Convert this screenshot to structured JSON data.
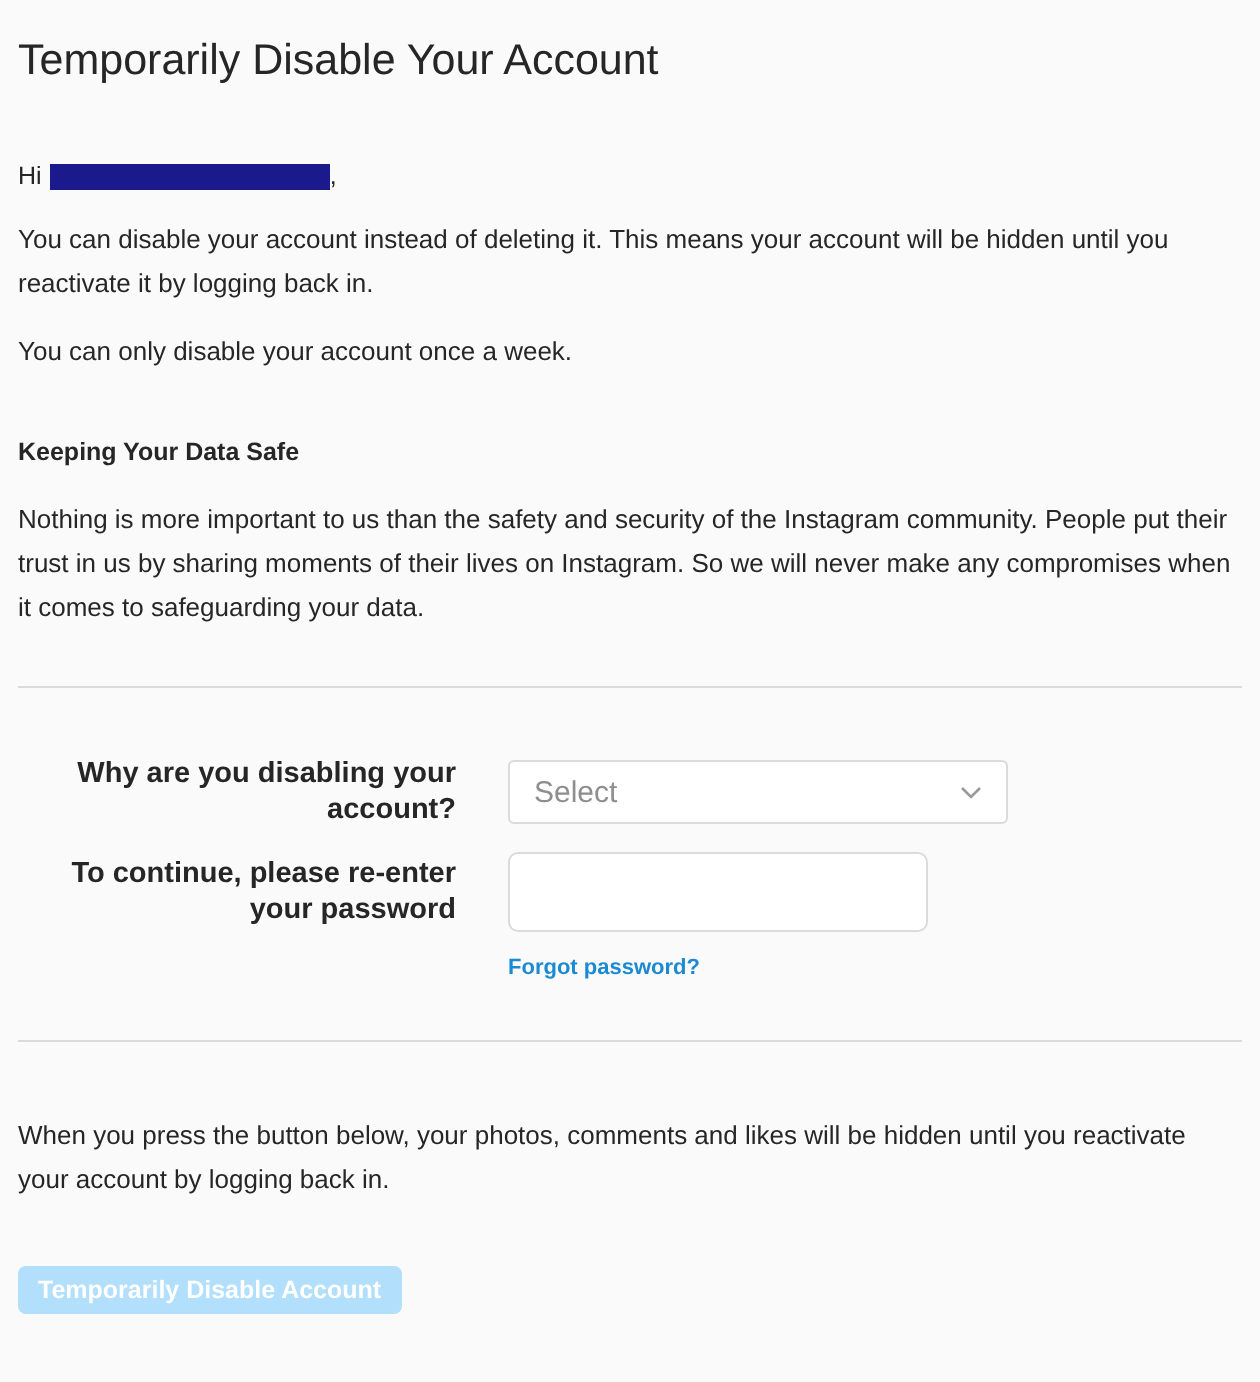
{
  "title": "Temporarily Disable Your Account",
  "greeting": {
    "prefix": "Hi",
    "suffix": ","
  },
  "intro": [
    "You can disable your account instead of deleting it. This means your account will be hidden until you reactivate it by logging back in.",
    "You can only disable your account once a week."
  ],
  "section": {
    "heading": "Keeping Your Data Safe",
    "text": "Nothing is more important to us than the safety and security of the Instagram community. People put their trust in us by sharing moments of their lives on Instagram. So we will never make any compromises when it comes to safeguarding your data."
  },
  "form": {
    "reason_label": "Why are you disabling your account?",
    "reason_placeholder": "Select",
    "password_label": "To continue, please re-enter your password",
    "forgot_link": "Forgot password?"
  },
  "notice": "When you press the button below, your photos, comments and likes will be hidden until you reactivate your account by logging back in.",
  "submit": {
    "label": "Temporarily Disable Account",
    "disabled": true
  }
}
